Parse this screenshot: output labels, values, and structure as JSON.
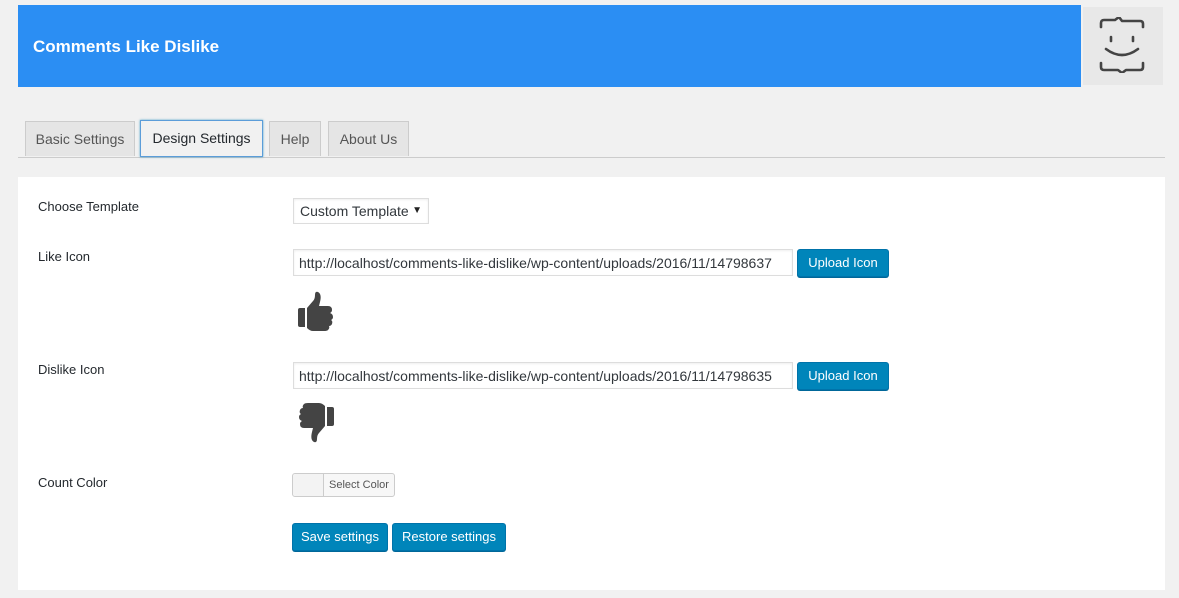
{
  "header": {
    "title": "Comments Like Dislike",
    "logo_icon": "smiley-face-icon",
    "background_color": "#2b8ef3"
  },
  "tabs": [
    {
      "label": "Basic Settings",
      "active": false
    },
    {
      "label": "Design Settings",
      "active": true
    },
    {
      "label": "Help",
      "active": false
    },
    {
      "label": "About Us",
      "active": false
    }
  ],
  "form": {
    "template": {
      "label": "Choose Template",
      "selected": "Custom Template"
    },
    "like_icon": {
      "label": "Like Icon",
      "url": "http://localhost/comments-like-dislike/wp-content/uploads/2016/11/14798637",
      "upload_label": "Upload Icon",
      "preview_icon": "thumbs-up-icon"
    },
    "dislike_icon": {
      "label": "Dislike Icon",
      "url": "http://localhost/comments-like-dislike/wp-content/uploads/2016/11/14798635",
      "upload_label": "Upload Icon",
      "preview_icon": "thumbs-down-icon"
    },
    "count_color": {
      "label": "Count Color",
      "picker_label": "Select Color"
    }
  },
  "actions": {
    "save_label": "Save settings",
    "restore_label": "Restore settings",
    "button_color": "#0085ba"
  }
}
